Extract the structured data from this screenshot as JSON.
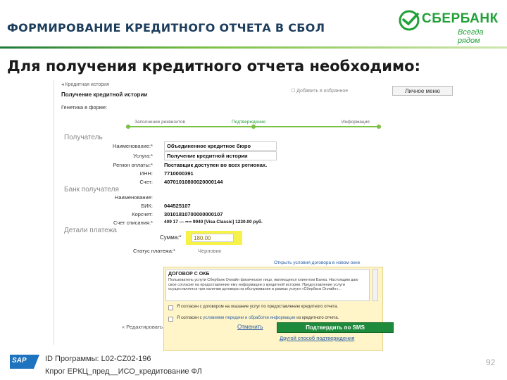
{
  "header": {
    "title": "ФОРМИРОВАНИЕ КРЕДИТНОГО ОТЧЕТА В СБОЛ",
    "logo_name": "СБЕРБАНК",
    "logo_tagline": "Всегда рядом",
    "brand_color": "#21a038"
  },
  "subheading": "Для получения кредитного отчета необходимо:",
  "app": {
    "breadcrumb": "◂ Кредитная история",
    "favorites": "Добавить в избранное",
    "personal_menu": "Личное меню",
    "page_title": "Получение кредитной истории",
    "template_label": "Генетика в форме:",
    "steps": [
      "Заполнение реквизитов",
      "Подтверждение",
      "Информация"
    ],
    "active_step": 1,
    "recipient": {
      "section": "Получатель",
      "fields": [
        {
          "label": "Наименование:*",
          "value": "Объединенное кредитное бюро"
        },
        {
          "label": "Услуга:*",
          "value": "Получение кредитной истории"
        },
        {
          "label": "Регион оплаты:*",
          "value": "Поставщик доступен во всех регионах."
        },
        {
          "label": "ИНН:",
          "value": "7710000391"
        },
        {
          "label": "Счет:",
          "value": "40701010800020000144"
        }
      ]
    },
    "bank": {
      "section": "Банк получателя",
      "fields": [
        {
          "label": "Наименование:",
          "value": ""
        },
        {
          "label": "БИК:",
          "value": "044525107"
        },
        {
          "label": "Корсчет:",
          "value": "30101810700000000107"
        },
        {
          "label": "Счет списания:*",
          "value": "409 17 — •••• 9940 [Visa Classic] 1230.00 руб."
        }
      ]
    },
    "payment": {
      "section": "Детали платежа",
      "amount_label": "Сумма:*",
      "amount_value": "180.00",
      "status_label": "Статус платежа:*",
      "status_value": "Черновик"
    },
    "terms_link": "Открыть условия договора в новом окне",
    "contract": {
      "title": "ДОГОВОР С ОКБ",
      "text": "Пользователь услуги Сбербанк Онлайн физическое лицо, являющееся клиентом Банка. Настоящим даю свое согласие на предоставление ему информации о кредитной истории. Предоставление услуги осуществляется при наличии договора на обслуживание в рамках услуги «Сбербанк Онлайн»..."
    },
    "consents": [
      {
        "text": "Я согласен с договором на оказание услуг по предоставлению кредитного отчета."
      },
      {
        "prefix": "Я согласен с ",
        "link": "условиями передачи и обработки информации",
        "suffix": " из кредитного отчета."
      }
    ],
    "back_label": "« Редактировать",
    "cancel_label": "Отменить",
    "confirm_label": "Подтвердить по SMS",
    "other_confirm_label": "Другой способ подтверждения"
  },
  "footer": {
    "sap_logo": "SAP",
    "program_id": "ID Программы: L02-CZ02-196",
    "program_path": "Кпрог ЕРКЦ_пред__ИСО_кредитование ФЛ",
    "page_number": "92"
  }
}
